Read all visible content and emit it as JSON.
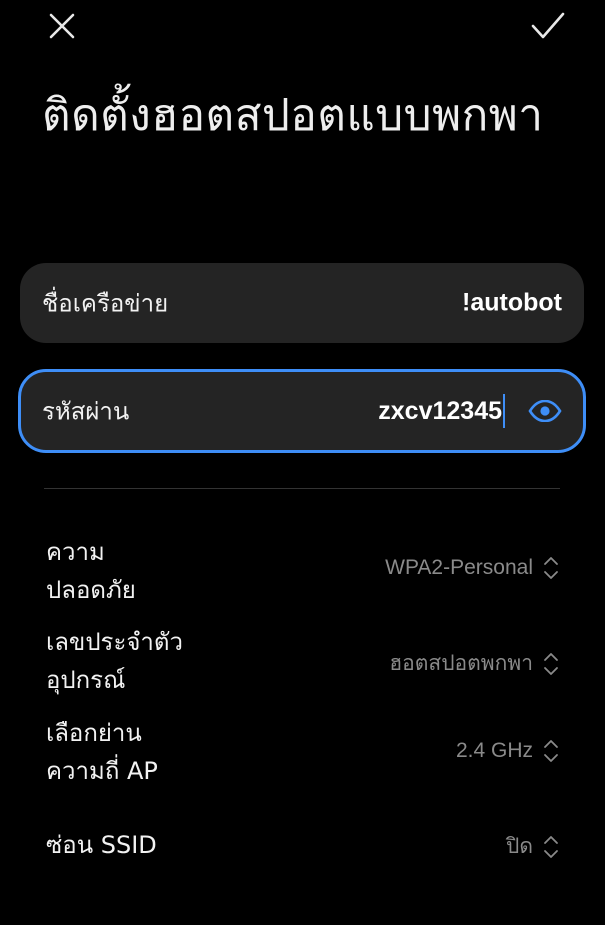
{
  "toolbar": {
    "close_icon": "close-icon",
    "confirm_icon": "check-icon"
  },
  "page": {
    "title": "ติดตั้งฮอตสปอตแบบพกพา"
  },
  "network_name": {
    "label": "ชื่อเครือข่าย",
    "value": "!autobot"
  },
  "password": {
    "label": "รหัสผ่าน",
    "value": "zxcv12345",
    "toggle_icon": "eye-icon",
    "accent": "#3e8ef7"
  },
  "settings": {
    "security": {
      "label_line1": "ความ",
      "label_line2": "ปลอดภัย",
      "value": "WPA2-Personal"
    },
    "device_id": {
      "label_line1": "เลขประจำตัว",
      "label_line2": "อุปกรณ์",
      "value": "ฮอตสปอตพกพา"
    },
    "band": {
      "label_line1": "เลือกย่าน",
      "label_line2": "ความถี่ AP",
      "value": "2.4 GHz"
    },
    "hide_ssid": {
      "label": "ซ่อน SSID",
      "value": "ปิด"
    }
  }
}
